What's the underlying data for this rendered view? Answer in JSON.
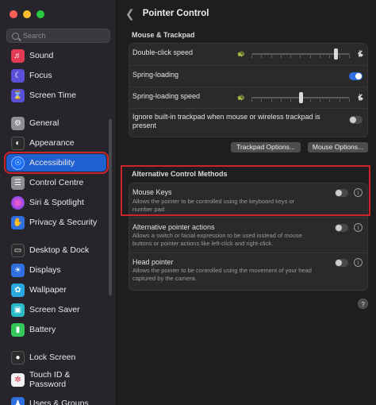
{
  "window": {
    "title": "Pointer Control",
    "traffic": [
      "#fe5f57",
      "#febc2e",
      "#28c840"
    ]
  },
  "search": {
    "placeholder": "Search"
  },
  "sidebar": {
    "items": [
      {
        "label": "Sound",
        "icon": "speaker-icon",
        "color": "#e43b55"
      },
      {
        "label": "Focus",
        "icon": "moon-icon",
        "color": "#5a50d8"
      },
      {
        "label": "Screen Time",
        "icon": "hourglass-icon",
        "color": "#5a50d8"
      },
      {
        "label": "General",
        "icon": "gear-icon",
        "color": "#8e8e93"
      },
      {
        "label": "Appearance",
        "icon": "appearance-icon",
        "color": "#2b2b2b"
      },
      {
        "label": "Accessibility",
        "icon": "accessibility-icon",
        "color": "#1a6ff5"
      },
      {
        "label": "Control Centre",
        "icon": "control-centre-icon",
        "color": "#8e8e93"
      },
      {
        "label": "Siri & Spotlight",
        "icon": "siri-icon",
        "color": "#b33ad6"
      },
      {
        "label": "Privacy & Security",
        "icon": "hand-icon",
        "color": "#2f6fe0"
      },
      {
        "label": "Desktop & Dock",
        "icon": "dock-icon",
        "color": "#2b2b2b"
      },
      {
        "label": "Displays",
        "icon": "sun-icon",
        "color": "#2f6fe0"
      },
      {
        "label": "Wallpaper",
        "icon": "wallpaper-icon",
        "color": "#2aa9e0"
      },
      {
        "label": "Screen Saver",
        "icon": "screensaver-icon",
        "color": "#2ab9c9"
      },
      {
        "label": "Battery",
        "icon": "battery-icon",
        "color": "#34c759"
      },
      {
        "label": "Lock Screen",
        "icon": "lock-icon",
        "color": "#2b2b2b"
      },
      {
        "label": "Touch ID & Password",
        "icon": "fingerprint-icon",
        "color": "#f2f2f2"
      },
      {
        "label": "Users & Groups",
        "icon": "users-icon",
        "color": "#2f6fe0"
      }
    ]
  },
  "mouse_trackpad": {
    "title": "Mouse & Trackpad",
    "double_click": {
      "label": "Double-click speed",
      "level": 0.86
    },
    "spring_loading": {
      "label": "Spring-loading",
      "on": true
    },
    "spring_speed": {
      "label": "Spring-loading speed",
      "level": 0.5
    },
    "ignore_trackpad": {
      "label": "Ignore built-in trackpad when mouse or wireless trackpad is present",
      "on": false
    },
    "trackpad_options": "Trackpad Options...",
    "mouse_options": "Mouse Options..."
  },
  "alt_control": {
    "title": "Alternative Control Methods",
    "mouse_keys": {
      "label": "Mouse Keys",
      "desc": "Allows the pointer to be controlled using the keyboard keys or number pad.",
      "on": false
    },
    "alt_pointer": {
      "label": "Alternative pointer actions",
      "desc": "Allows a switch or facial expression to be used instead of mouse buttons or pointer actions like left-click and right-click.",
      "on": false
    },
    "head_pointer": {
      "label": "Head pointer",
      "desc": "Allows the pointer to be controlled using the movement of your head captured by the camera.",
      "on": false
    }
  },
  "help": "?"
}
